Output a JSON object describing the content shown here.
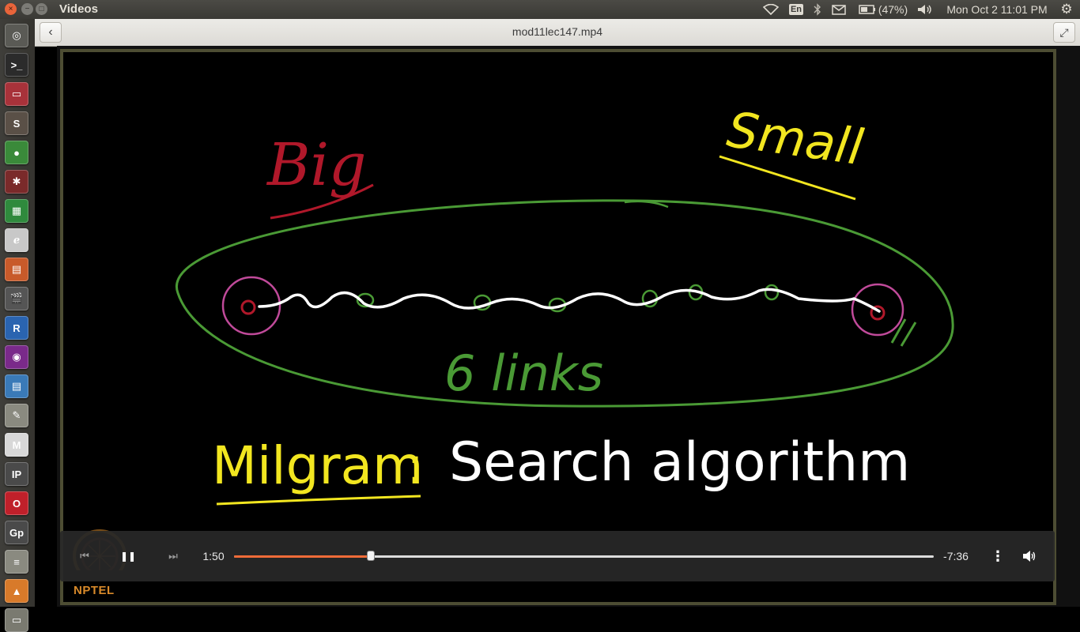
{
  "window": {
    "app_title": "Videos",
    "close": "×",
    "minimize": "−",
    "maximize": "□"
  },
  "tray": {
    "keyboard": "En",
    "battery": "(47%)",
    "clock": "Mon Oct  2 11:01 PM"
  },
  "player": {
    "file_title": "mod11lec147.mp4",
    "back_glyph": "‹",
    "fullscreen_glyph": "⤢"
  },
  "board": {
    "word_big": "Big",
    "word_small": "Small",
    "links_label": "6 links",
    "milgram_label": "Milgram",
    "search_label": "Search algorithm",
    "colors": {
      "red": "#b0182a",
      "yellow": "#f2e620",
      "green": "#4a9a35",
      "white": "#ffffff",
      "pink": "#c04a9a"
    }
  },
  "controls": {
    "elapsed": "1:50",
    "remaining": "-7:36",
    "progress": 0.195,
    "prev_glyph": "⏮",
    "pause_glyph": "❚❚",
    "next_glyph": "⏭",
    "menu_glyph": "⋮",
    "volume_glyph": "🔊"
  },
  "branding": {
    "logo_text": "NPTEL",
    "accent": "#d98a2a"
  },
  "launcher": {
    "items": [
      {
        "name": "dash-icon",
        "glyph": "◎",
        "color": "#5a5a55"
      },
      {
        "name": "terminal-icon",
        "glyph": ">_",
        "color": "#2b2b2b"
      },
      {
        "name": "files-icon",
        "glyph": "▭",
        "color": "#a8323a"
      },
      {
        "name": "sublime-icon",
        "glyph": "S",
        "color": "#5a5047"
      },
      {
        "name": "chrome-icon",
        "glyph": "●",
        "color": "#3a8a3a"
      },
      {
        "name": "settings-icon",
        "glyph": "✱",
        "color": "#7a2a2a"
      },
      {
        "name": "spreadsheet-icon",
        "glyph": "▦",
        "color": "#2f8a3d"
      },
      {
        "name": "writer-icon",
        "glyph": "ℯ",
        "color": "#c8c8c8"
      },
      {
        "name": "impress-icon",
        "glyph": "▤",
        "color": "#c85a2a"
      },
      {
        "name": "video-icon",
        "glyph": "🎬",
        "color": "#555"
      },
      {
        "name": "r-icon",
        "glyph": "R",
        "color": "#2a64b0"
      },
      {
        "name": "media-icon",
        "glyph": "◉",
        "color": "#7a2a8a"
      },
      {
        "name": "document-icon",
        "glyph": "▤",
        "color": "#3a7ab8"
      },
      {
        "name": "editor-icon",
        "glyph": "✎",
        "color": "#8a8a80"
      },
      {
        "name": "gmail-icon",
        "glyph": "M",
        "color": "#d8d8d8"
      },
      {
        "name": "ipython-icon",
        "glyph": "IP",
        "color": "#4a4a4a"
      },
      {
        "name": "opera-icon",
        "glyph": "O",
        "color": "#c0202a"
      },
      {
        "name": "gnuplot-icon",
        "glyph": "Gp",
        "color": "#4a4a4a"
      },
      {
        "name": "drive-icon",
        "glyph": "≡",
        "color": "#8a8a80"
      },
      {
        "name": "installer-icon",
        "glyph": "▲",
        "color": "#d87a2a"
      },
      {
        "name": "trash-icon",
        "glyph": "▭",
        "color": "#7a7a70"
      }
    ]
  }
}
